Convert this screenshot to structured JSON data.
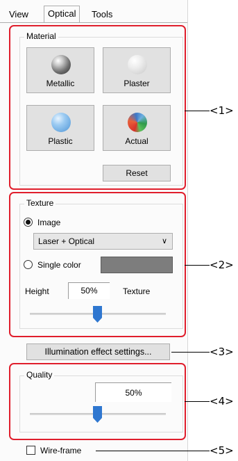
{
  "tabs": [
    {
      "label": "View",
      "active": false
    },
    {
      "label": "Optical",
      "active": true
    },
    {
      "label": "Tools",
      "active": false
    }
  ],
  "material": {
    "title": "Material",
    "buttons": [
      {
        "label": "Metallic",
        "icon": "metallic-sphere-icon"
      },
      {
        "label": "Plaster",
        "icon": "plaster-sphere-icon"
      },
      {
        "label": "Plastic",
        "icon": "plastic-sphere-icon"
      },
      {
        "label": "Actual",
        "icon": "actual-sphere-icon"
      }
    ],
    "reset_label": "Reset"
  },
  "texture": {
    "title": "Texture",
    "image_label": "Image",
    "image_selected": true,
    "image_option": "Laser + Optical",
    "single_color_label": "Single color",
    "single_color_value": "#7d7d7d",
    "height_label": "Height",
    "height_value": "50%",
    "texture_label": "Texture",
    "slider_value": 0.5
  },
  "illumination_button": "Illumination effect settings...",
  "quality": {
    "title": "Quality",
    "value": "50%",
    "slider_value": 0.5
  },
  "wireframe": {
    "label": "Wire-frame",
    "checked": false
  },
  "callouts": [
    "<1>",
    "<2>",
    "<3>",
    "<4>",
    "<5>"
  ],
  "colors": {
    "highlight": "#e01e2c",
    "slider_thumb": "#2f77d0"
  }
}
